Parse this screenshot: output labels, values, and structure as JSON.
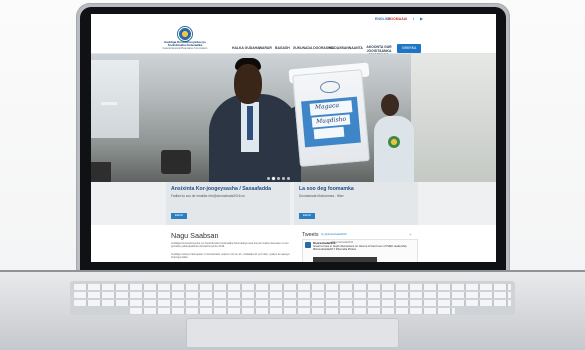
{
  "site": {
    "org_name": "Guddiga Doorashooyinka iyo Soohdimaha Federaalka",
    "org_subtitle": "Federal Electoral Boundaries Commission",
    "lang_1": "ENGLISH",
    "lang_2": "SOOMAALI"
  },
  "nav": {
    "items": [
      "HALKA GUDAHA",
      "WARAR",
      "BAGASH",
      "XUKUNADA DOORASHO",
      "MADAXBANNAANTA"
    ],
    "multi": "AKOONTA GUR\nJOOGITAANKA MAAMULKA",
    "button": "XIRIIRKA"
  },
  "hero": {
    "handwriting_1": "Magaca",
    "handwriting_2": "Muqdisho"
  },
  "cards": [
    {
      "title": "Ansixinta Kor-joogeysasha / Saxaafadda",
      "subtitle": "Fadlan ku soo dir emailka info@doorashada2016.so",
      "button": "EEGSI"
    },
    {
      "title": "La soo deg foomamka",
      "subtitle": "Doorashada Musharraxa - Warr",
      "button": "EEGSI"
    }
  ],
  "news": {
    "title": "Nagu Saabsan",
    "p1": "Guddiga Doorashooyinka iyo Soohdimaha Federaalka Soomaaliya waa hay'ad madax-bannaan oo loo igmaday qabanqaabinta doorashooyinka 2016.",
    "p2": "Guddigu waxay hubinayaan in doorashadu noqoto mid xor ah, cadaalad ah oo hufan, iyadoo la raacayo sharciga dalka."
  },
  "tweets": {
    "title": "Tweets",
    "by": "by @doorashada2016",
    "plus": "+",
    "name": "Doorashada2016",
    "handle": "@doorashada2016",
    "text": "Great to have in depth discussions on closure & hand over of ISIEC leadership. #Doorashada2017 #Somalia #Votes",
    "avatar_color": "#2a6aa8"
  }
}
